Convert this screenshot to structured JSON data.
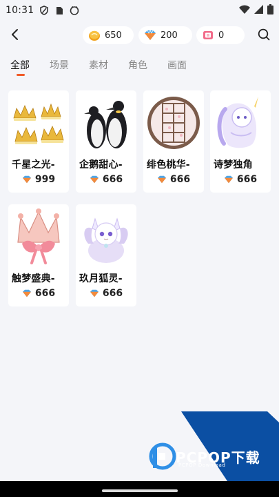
{
  "status_bar": {
    "time": "10:31",
    "icons": [
      "shield-icon",
      "sim-card-icon",
      "face-icon"
    ],
    "right_icons": [
      "wifi-icon",
      "signal-icon",
      "battery-icon"
    ]
  },
  "header": {
    "back_icon": "chevron-left-icon",
    "coins": "650",
    "gems": "200",
    "tickets": "0",
    "search_icon": "search-icon"
  },
  "tabs": [
    {
      "label": "全部",
      "active": true
    },
    {
      "label": "场景",
      "active": false
    },
    {
      "label": "素材",
      "active": false
    },
    {
      "label": "角色",
      "active": false
    },
    {
      "label": "画面",
      "active": false
    }
  ],
  "items": [
    {
      "name": "千星之光-",
      "price": "999",
      "art": "crowns"
    },
    {
      "name": "企鹅甜心-",
      "price": "666",
      "art": "penguins"
    },
    {
      "name": "绯色桃华-",
      "price": "666",
      "art": "round-window"
    },
    {
      "name": "诗梦独角",
      "price": "666",
      "art": "unicorn"
    },
    {
      "name": "触梦盛典-",
      "price": "666",
      "art": "pink-crown"
    },
    {
      "name": "玖月狐灵-",
      "price": "666",
      "art": "fox"
    }
  ],
  "watermark": {
    "title": "PCPOP下载",
    "subtitle": "PCPOP Download"
  },
  "colors": {
    "accent": "#f05a28",
    "background": "#f4f5f9",
    "watermark_blue": "#0b4fa3"
  }
}
